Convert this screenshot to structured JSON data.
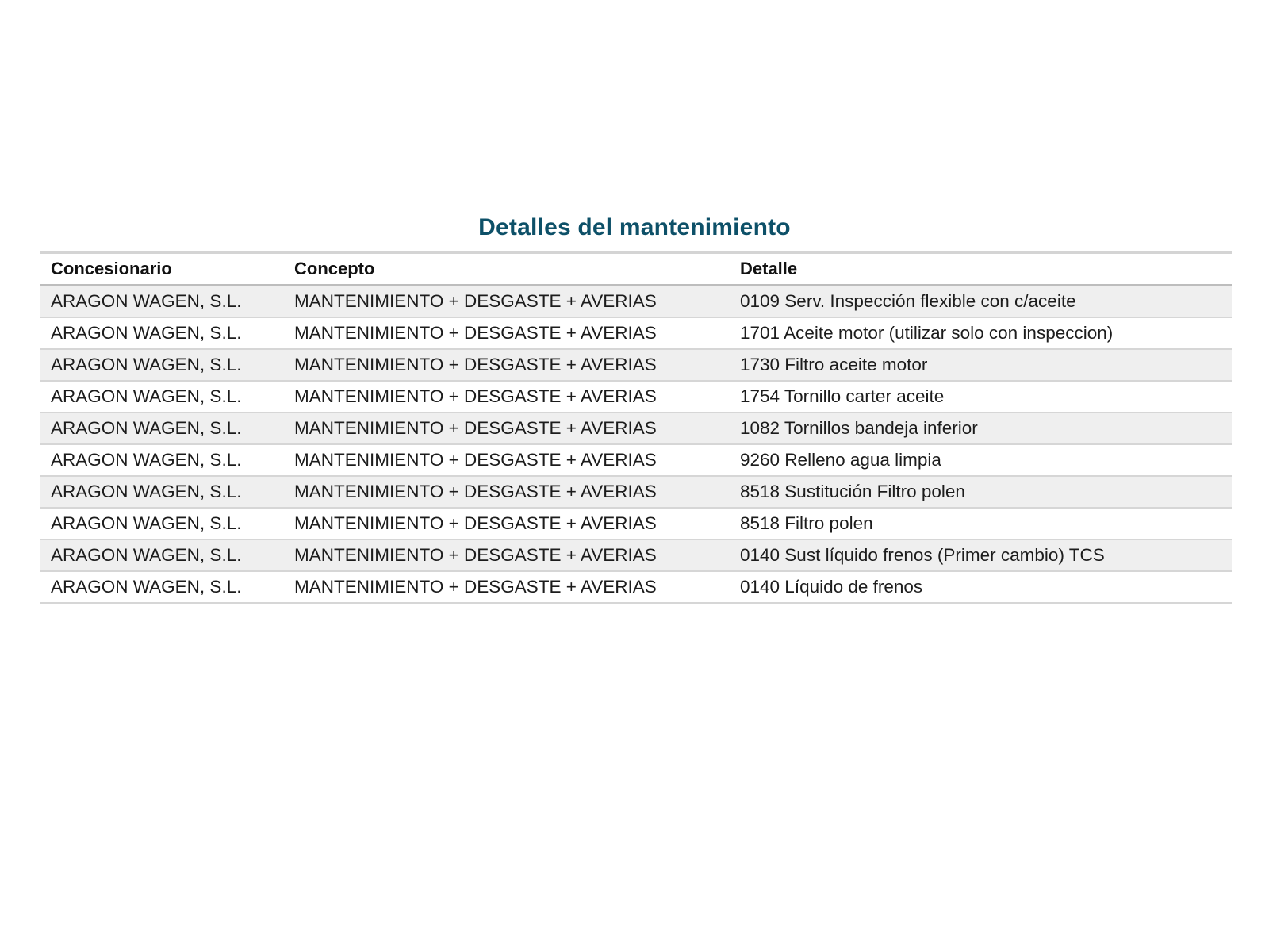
{
  "title": "Detalles del mantenimiento",
  "table": {
    "headers": [
      "Concesionario",
      "Concepto",
      "Detalle"
    ],
    "rows": [
      [
        "ARAGON WAGEN, S.L.",
        "MANTENIMIENTO + DESGASTE + AVERIAS",
        "0109 Serv. Inspección flexible con c/aceite"
      ],
      [
        "ARAGON WAGEN, S.L.",
        "MANTENIMIENTO + DESGASTE + AVERIAS",
        "1701 Aceite motor (utilizar solo con inspeccion)"
      ],
      [
        "ARAGON WAGEN, S.L.",
        "MANTENIMIENTO + DESGASTE + AVERIAS",
        "1730 Filtro aceite motor"
      ],
      [
        "ARAGON WAGEN, S.L.",
        "MANTENIMIENTO + DESGASTE + AVERIAS",
        "1754 Tornillo carter aceite"
      ],
      [
        "ARAGON WAGEN, S.L.",
        "MANTENIMIENTO + DESGASTE + AVERIAS",
        "1082 Tornillos bandeja inferior"
      ],
      [
        "ARAGON WAGEN, S.L.",
        "MANTENIMIENTO + DESGASTE + AVERIAS",
        "9260 Relleno agua limpia"
      ],
      [
        "ARAGON WAGEN, S.L.",
        "MANTENIMIENTO + DESGASTE + AVERIAS",
        "8518 Sustitución Filtro polen"
      ],
      [
        "ARAGON WAGEN, S.L.",
        "MANTENIMIENTO + DESGASTE + AVERIAS",
        "8518 Filtro polen"
      ],
      [
        "ARAGON WAGEN, S.L.",
        "MANTENIMIENTO + DESGASTE + AVERIAS",
        "0140 Sust líquido frenos (Primer cambio) TCS"
      ],
      [
        "ARAGON WAGEN, S.L.",
        "MANTENIMIENTO + DESGASTE + AVERIAS",
        "0140 Líquido de frenos"
      ]
    ]
  },
  "colors": {
    "title": "#0d5068",
    "row_alt": "#efefef",
    "rule": "#d6d6d6"
  }
}
